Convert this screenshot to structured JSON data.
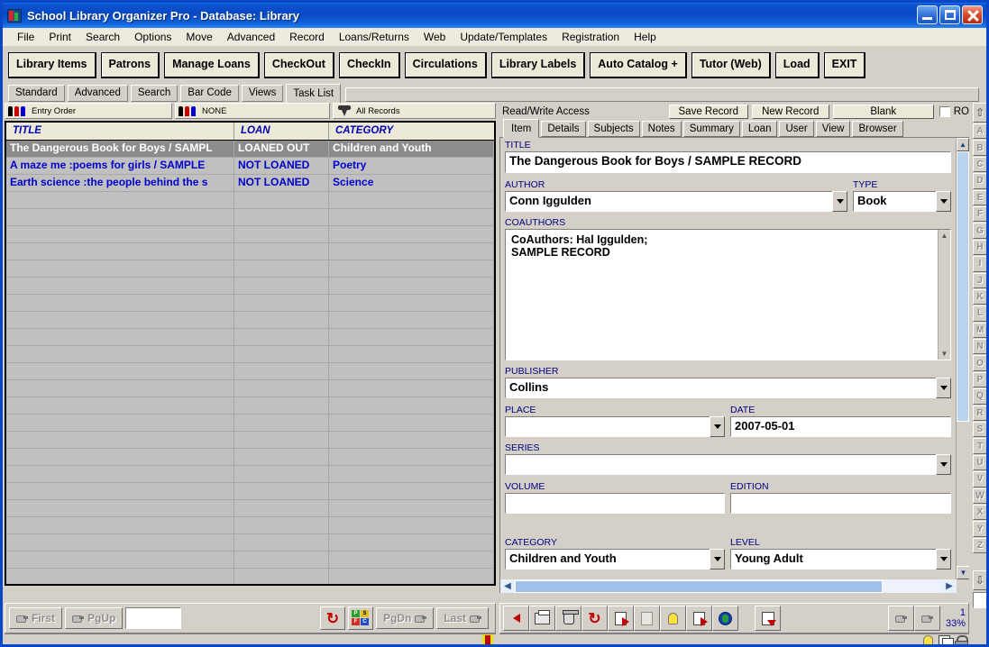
{
  "window": {
    "title": "School Library Organizer Pro - Database: Library",
    "icon": "app-icon",
    "minimize": "_",
    "maximize": "□",
    "close": "✕"
  },
  "menu": [
    "File",
    "Print",
    "Search",
    "Options",
    "Move",
    "Advanced",
    "Record",
    "Loans/Returns",
    "Web",
    "Update/Templates",
    "Registration",
    "Help"
  ],
  "toolbar_buttons": [
    "Library Items",
    "Patrons",
    "Manage Loans",
    "CheckOut",
    "CheckIn",
    "Circulations",
    "Library Labels",
    "Auto Catalog +",
    "Tutor (Web)",
    "Load",
    "EXIT"
  ],
  "subtabs": {
    "items": [
      "Standard",
      "Advanced",
      "Search",
      "Bar Code",
      "Views",
      "Task List"
    ],
    "active": "Task List"
  },
  "list_panel": {
    "sort_bar": [
      {
        "icon": "people-icon",
        "label": "Entry Order"
      },
      {
        "icon": "people-icon",
        "label": "NONE"
      },
      {
        "icon": "funnel-icon",
        "label": "All Records"
      }
    ],
    "columns": [
      "TITLE",
      "LOAN",
      "CATEGORY"
    ],
    "rows": [
      {
        "title": "The Dangerous Book for Boys / SAMPL",
        "loan": "LOANED OUT",
        "category": "Children and Youth",
        "selected": true
      },
      {
        "title": "A maze me :poems for girls / SAMPLE",
        "loan": "NOT LOANED",
        "category": "Poetry",
        "selected": false
      },
      {
        "title": "Earth science :the people behind the s",
        "loan": "NOT LOANED",
        "category": "Science",
        "selected": false
      }
    ],
    "empty_row_count": 24
  },
  "list_nav": {
    "first": "First",
    "pgup": "PgUp",
    "pgdn": "PgDn",
    "last": "Last",
    "record_field_value": "",
    "refresh_icon": "refresh-clock-icon",
    "blocks_icon": "color-blocks-icon"
  },
  "record_panel": {
    "access_label": "Read/Write Access",
    "save_label": "Save Record",
    "new_label": "New Record",
    "blank_label": "Blank",
    "ro_label": "RO",
    "ro_checked": false,
    "tabs": [
      "Item",
      "Details",
      "Subjects",
      "Notes",
      "Summary",
      "Loan",
      "User",
      "View",
      "Browser"
    ],
    "active_tab": "Item",
    "fields": {
      "title_label": "TITLE",
      "title_value": "The Dangerous Book for Boys / SAMPLE RECORD",
      "author_label": "AUTHOR",
      "author_value": "Conn Iggulden",
      "type_label": "TYPE",
      "type_value": "Book",
      "coauthors_label": "COAUTHORS",
      "coauthors_line1": "CoAuthors: Hal Iggulden;",
      "coauthors_line2": "SAMPLE RECORD",
      "publisher_label": "PUBLISHER",
      "publisher_value": "Collins",
      "place_label": "PLACE",
      "place_value": "",
      "date_label": "DATE",
      "date_value": "2007-05-01",
      "series_label": "SERIES",
      "series_value": "",
      "volume_label": "VOLUME",
      "volume_value": "",
      "edition_label": "EDITION",
      "edition_value": "",
      "category_label": "CATEGORY",
      "category_value": "Children and Youth",
      "level_label": "LEVEL",
      "level_value": "Young Adult"
    }
  },
  "alpha_rail": {
    "up": "⇧",
    "down": "⇩",
    "letters": [
      "A",
      "B",
      "C",
      "D",
      "E",
      "F",
      "G",
      "H",
      "I",
      "J",
      "K",
      "L",
      "M",
      "N",
      "O",
      "P",
      "Q",
      "R",
      "S",
      "T",
      "U",
      "V",
      "W",
      "X",
      "Y",
      "Z"
    ]
  },
  "record_toolbar": {
    "icons": [
      "back-arrow-icon",
      "print-icon",
      "delete-icon",
      "refresh-clock-icon",
      "document-red-icon",
      "document-disabled-icon",
      "bulb-icon",
      "export-document-icon",
      "globe-icon",
      "save-document-icon"
    ],
    "nav_icons": [
      "prev-hand-icon",
      "next-hand-icon"
    ],
    "record_number": "1",
    "zoom_percent": "33%"
  },
  "status_bar": {
    "icons": [
      "bulb-icon",
      "copy-icon",
      "lock-icon"
    ]
  },
  "colors": {
    "title_gradient_start": "#1d6fe8",
    "title_gradient_end": "#0848c4",
    "face": "#d4d0c8",
    "button_face": "#ece9d8",
    "label_blue": "#000080",
    "row_text": "#0000cc",
    "selected_row": "#8c8c8c",
    "accent_red": "#c00000"
  }
}
